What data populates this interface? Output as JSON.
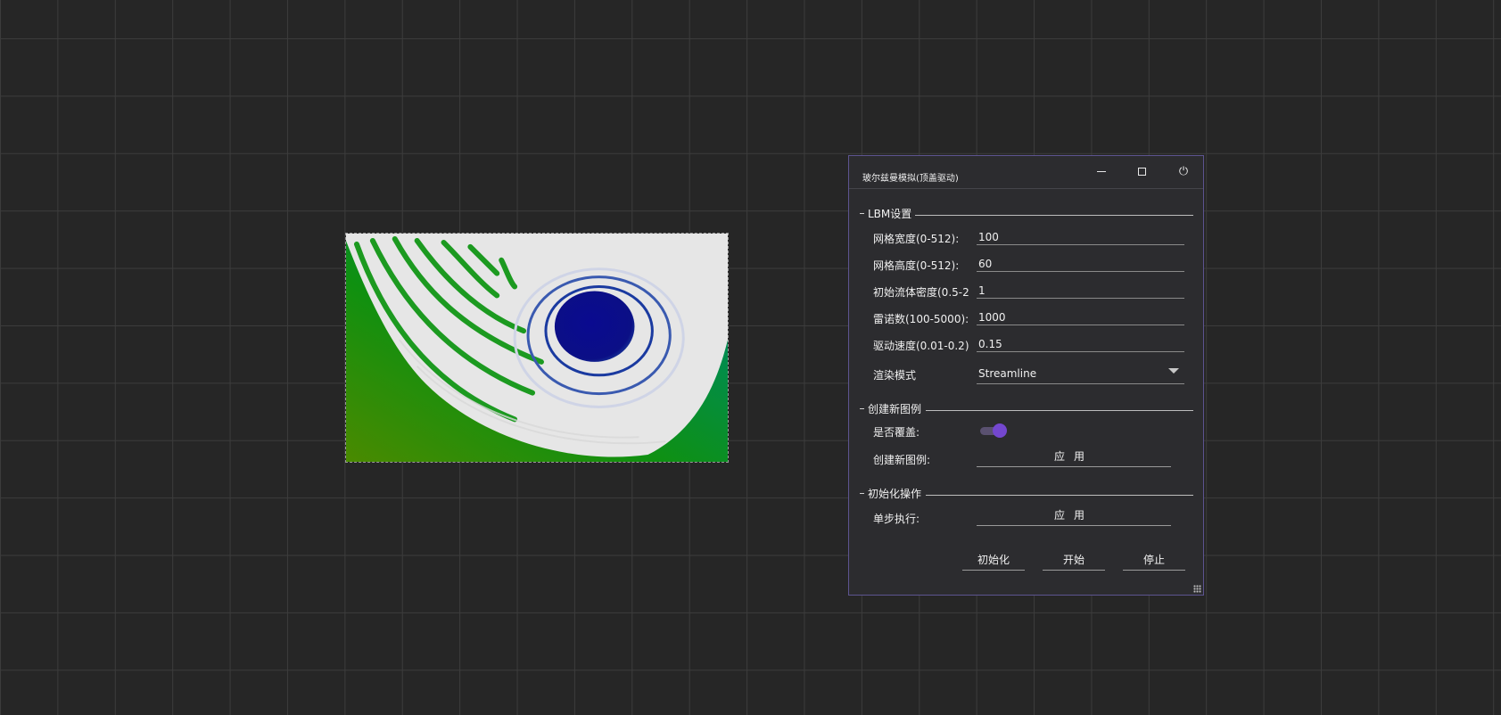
{
  "canvas": {
    "description_icon": "simulation-canvas"
  },
  "panel": {
    "title": "玻尔兹曼模拟(顶盖驱动)",
    "window_controls": {
      "minimize_icon": "minimize-icon",
      "maximize_icon": "maximize-icon",
      "power_icon": "power-icon",
      "power_glyph": "⏻"
    },
    "sections": {
      "lbm": {
        "title": "LBM设置",
        "fields": [
          {
            "label": "网格宽度(0-512):",
            "value": "100"
          },
          {
            "label": "网格高度(0-512):",
            "value": "60"
          },
          {
            "label": "初始流体密度(0.5-2",
            "value": "1"
          },
          {
            "label": "雷诺数(100-5000):",
            "value": "1000"
          },
          {
            "label": "驱动速度(0.01-0.2)",
            "value": "0.15"
          }
        ],
        "render_mode": {
          "label": "渲染模式",
          "value": "Streamline"
        }
      },
      "create": {
        "title": "创建新图例",
        "overwrite_label": "是否覆盖:",
        "overwrite_on": true,
        "create_label": "创建新图例:",
        "apply_label": "应用"
      },
      "init": {
        "title": "初始化操作",
        "step_label": "单步执行:",
        "apply_label": "应用"
      }
    },
    "buttons": {
      "init": "初始化",
      "start": "开始",
      "stop": "停止"
    }
  },
  "colors": {
    "background": "#262626",
    "panel": "#2c2c2f",
    "panel_border": "#5d5490",
    "toggle_accent": "#7447cf",
    "vortex": "#0a0a8a",
    "flow_green": "#0f8a10"
  }
}
